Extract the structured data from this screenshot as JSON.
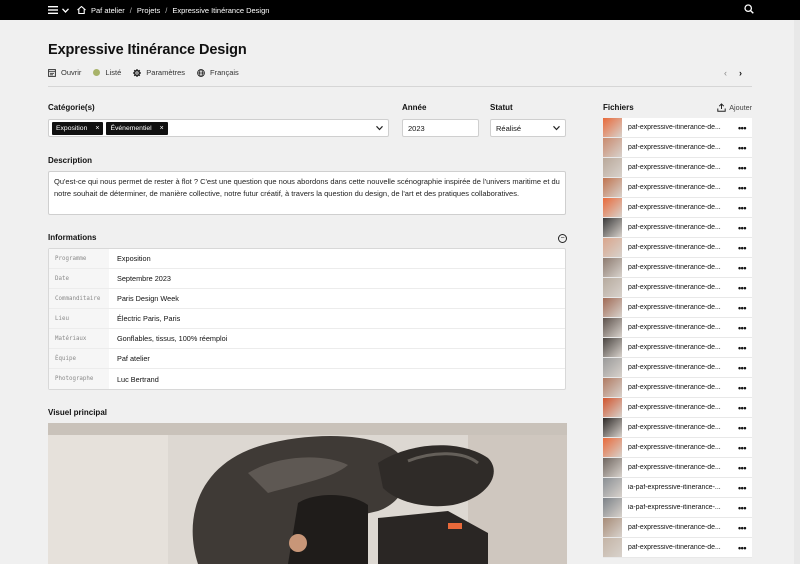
{
  "topbar": {
    "crumbs": [
      "Paf atelier",
      "Projets",
      "Expressive Itinérance Design"
    ]
  },
  "page": {
    "title": "Expressive Itinérance Design",
    "actions": {
      "open": "Ouvrir",
      "status": "Listé",
      "settings": "Paramètres",
      "language": "Français"
    }
  },
  "form": {
    "categories_label": "Catégorie(s)",
    "categories": [
      "Exposition",
      "Événementiel"
    ],
    "year_label": "Année",
    "year": "2023",
    "status_label": "Statut",
    "status": "Réalisé",
    "description_label": "Description",
    "description": "Qu'est-ce qui nous permet de rester à flot ? C'est une question que nous abordons dans cette nouvelle scénographie inspirée de l'univers maritime et du notre souhait de déterminer, de manière collective, notre futur créatif, à travers la question du design, de l'art et des pratiques collaboratives."
  },
  "info": {
    "label": "Informations",
    "rows": [
      {
        "k": "Programme",
        "v": "Exposition"
      },
      {
        "k": "Date",
        "v": "Septembre 2023"
      },
      {
        "k": "Commanditaire",
        "v": "Paris Design Week"
      },
      {
        "k": "Lieu",
        "v": "Électric Paris, Paris"
      },
      {
        "k": "Matériaux",
        "v": "Gonflables, tissus, 100% réemploi"
      },
      {
        "k": "Équipe",
        "v": "Paf atelier"
      },
      {
        "k": "Photographe",
        "v": "Luc Bertrand"
      }
    ]
  },
  "visual": {
    "label": "Visuel principal"
  },
  "files": {
    "label": "Fichiers",
    "add": "Ajouter",
    "items": [
      {
        "name": "paf-expressive-itinerance-de...",
        "color": "#e8693a"
      },
      {
        "name": "paf-expressive-itinerance-de...",
        "color": "#c98a6e"
      },
      {
        "name": "paf-expressive-itinerance-de...",
        "color": "#b9a89a"
      },
      {
        "name": "paf-expressive-itinerance-de...",
        "color": "#c0734f"
      },
      {
        "name": "paf-expressive-itinerance-de...",
        "color": "#e8693a"
      },
      {
        "name": "paf-expressive-itinerance-de...",
        "color": "#3a3a3a"
      },
      {
        "name": "paf-expressive-itinerance-de...",
        "color": "#d9a58c"
      },
      {
        "name": "paf-expressive-itinerance-de...",
        "color": "#8d7b70"
      },
      {
        "name": "paf-expressive-itinerance-de...",
        "color": "#b6aa9e"
      },
      {
        "name": "paf-expressive-itinerance-de...",
        "color": "#a06a55"
      },
      {
        "name": "paf-expressive-itinerance-de...",
        "color": "#5d524c"
      },
      {
        "name": "paf-expressive-itinerance-de...",
        "color": "#4a4541"
      },
      {
        "name": "paf-expressive-itinerance-de...",
        "color": "#9a9a9a"
      },
      {
        "name": "paf-expressive-itinerance-de...",
        "color": "#b07a62"
      },
      {
        "name": "paf-expressive-itinerance-de...",
        "color": "#d0542d"
      },
      {
        "name": "paf-expressive-itinerance-de...",
        "color": "#2e2a28"
      },
      {
        "name": "paf-expressive-itinerance-de...",
        "color": "#e8693a"
      },
      {
        "name": "paf-expressive-itinerance-de...",
        "color": "#6f6660"
      },
      {
        "name": "ia-paf-expressive-itinerance-...",
        "color": "#8a8f94"
      },
      {
        "name": "ia-paf-expressive-itinerance-...",
        "color": "#7c8288"
      },
      {
        "name": "paf-expressive-itinerance-de...",
        "color": "#a78c78"
      },
      {
        "name": "paf-expressive-itinerance-de...",
        "color": "#c4b4a6"
      }
    ]
  }
}
